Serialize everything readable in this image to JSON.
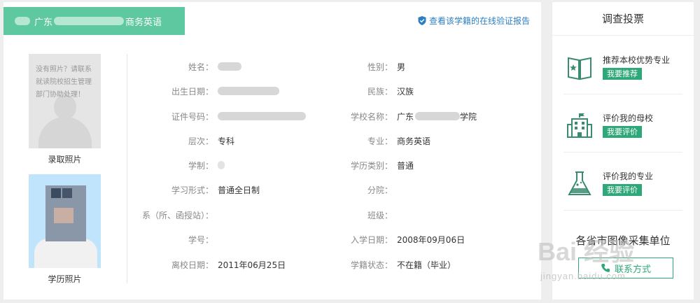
{
  "header": {
    "school_prefix": "广东",
    "major_suffix": "商务英语",
    "verify_link": "查看该学籍的在线验证报告"
  },
  "photos": {
    "missing_message": "没有照片？请联系就读院校招生管理部门协助处理！",
    "admission_caption": "录取照片",
    "degree_caption": "学历照片"
  },
  "fields": {
    "name_label": "姓名：",
    "gender_label": "性别：",
    "gender_value": "男",
    "dob_label": "出生日期：",
    "ethnicity_label": "民族：",
    "ethnicity_value": "汉族",
    "id_label": "证件号码：",
    "school_label": "学校名称：",
    "school_prefix": "广东",
    "school_suffix": "学院",
    "level_label": "层次：",
    "level_value": "专科",
    "major_label": "专业：",
    "major_value": "商务英语",
    "duration_label": "学制：",
    "category_label": "学历类别：",
    "category_value": "普通",
    "form_label": "学习形式：",
    "form_value": "普通全日制",
    "branch_label": "分院：",
    "dept_label": "系（所、函授站）：",
    "class_label": "班级：",
    "student_no_label": "学号：",
    "enroll_label": "入学日期：",
    "enroll_value": "2008年09月06日",
    "leave_label": "离校日期：",
    "leave_value": "2011年06月25日",
    "status_label": "学籍状态：",
    "status_value": "不在籍（毕业）"
  },
  "sidebar": {
    "title": "调查投票",
    "items": [
      {
        "text": "推荐本校优势专业",
        "button": "我要推荐",
        "icon": "book-star-icon"
      },
      {
        "text": "评价我的母校",
        "button": "我要评价",
        "icon": "school-building-icon"
      },
      {
        "text": "评价我的专业",
        "button": "我要评价",
        "icon": "flask-icon"
      }
    ],
    "collect_title": "各省市图像采集单位",
    "contact_button": "联系方式"
  },
  "watermark": {
    "logo": "Bai 经验",
    "url": "jingyan.baidu.com"
  },
  "colors": {
    "brand_green": "#5ec8a0",
    "button_green": "#2fa879",
    "link_blue": "#2d7fc1"
  }
}
